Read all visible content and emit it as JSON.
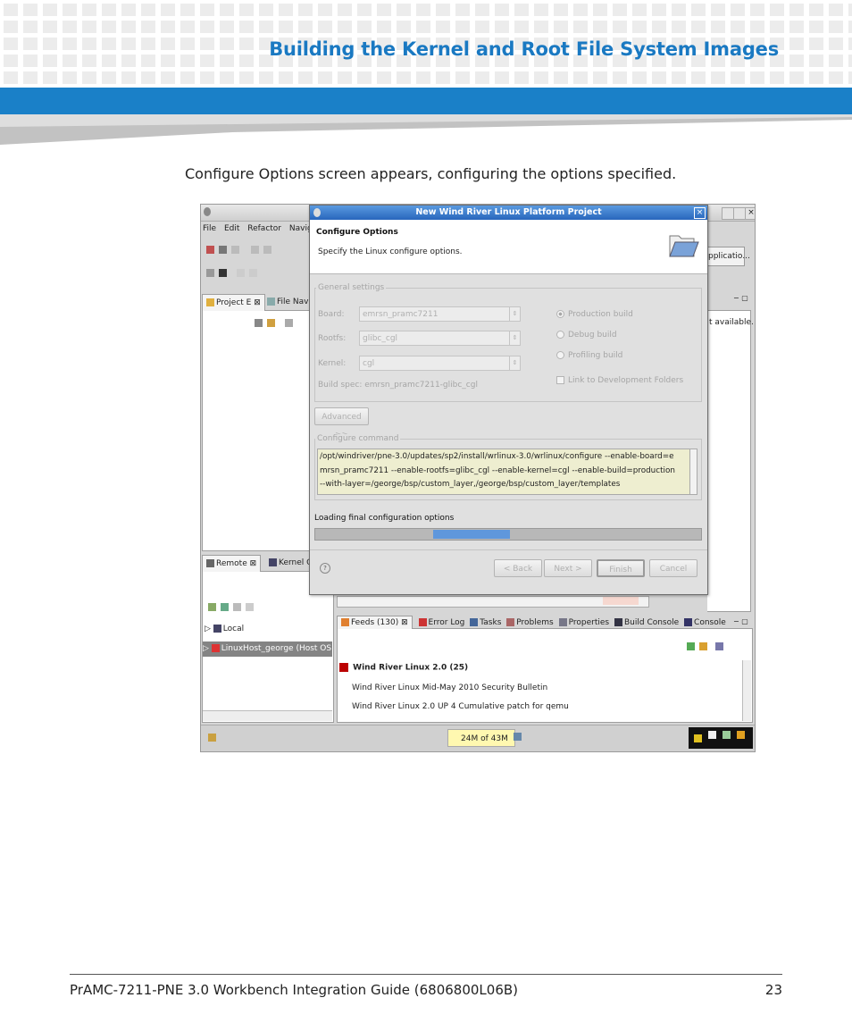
{
  "header": {
    "title": "Building the Kernel and Root File System Images"
  },
  "intro": "Configure Options screen appears, configuring the options specified.",
  "ide": {
    "menu": [
      "File",
      "Edit",
      "Refactor",
      "Navigate"
    ],
    "tabs_top": [
      "Project E",
      "File Navi"
    ],
    "tabs_bottom_left": [
      "Remote",
      "Kernel O"
    ],
    "remote_items": [
      "Local",
      "LinuxHost_george (Host OS (Na"
    ],
    "right_fragments": {
      "application": "pplicatio...",
      "not_available": "t available."
    },
    "bottom_tabs": [
      "Feeds (130)",
      "Error Log",
      "Tasks",
      "Problems",
      "Properties",
      "Build Console",
      "Console"
    ],
    "feed_title": "Wind River Linux 2.0 (25)",
    "feed_items": [
      "Wind River Linux Mid-May 2010 Security Bulletin",
      "Wind River Linux 2.0 UP 4 Cumulative patch for qemu"
    ],
    "memory": "24M of 43M"
  },
  "dialog": {
    "title": "New Wind River Linux Platform Project",
    "heading": "Configure Options",
    "subheading": "Specify the Linux configure options.",
    "general_settings": "General settings",
    "board_label": "Board:",
    "board_value": "emrsn_pramc7211",
    "rootfs_label": "Rootfs:",
    "rootfs_value": "glibc_cgl",
    "kernel_label": "Kernel:",
    "kernel_value": "cgl",
    "build_spec": "Build spec: emrsn_pramc7211-glibc_cgl",
    "radio_production": "Production build",
    "radio_debug": "Debug build",
    "radio_profiling": "Profiling build",
    "link_folders": "Link to Development Folders",
    "advanced": "Advanced >>",
    "configure_command_label": "Configure command",
    "configure_command": "/opt/windriver/pne-3.0/updates/sp2/install/wrlinux-3.0/wrlinux/configure --enable-board=emrsn_pramc7211 --enable-rootfs=glibc_cgl --enable-kernel=cgl --enable-build=production --with-layer=/george/bsp/custom_layer,/george/bsp/custom_layer/templates",
    "status": "Loading final configuration options",
    "progress": 0.25,
    "buttons": {
      "back": "< Back",
      "next": "Next >",
      "finish": "Finish",
      "cancel": "Cancel"
    }
  },
  "footer": {
    "doc": "PrAMC-7211-PNE 3.0  Workbench Integration Guide (6806800L06B)",
    "page": "23"
  }
}
